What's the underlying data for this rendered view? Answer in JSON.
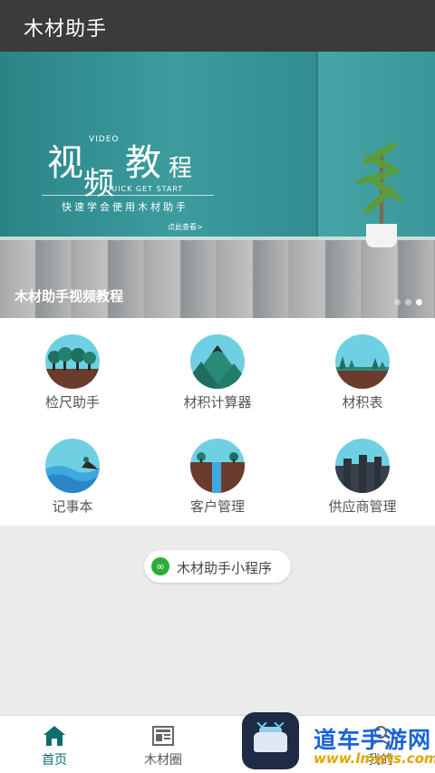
{
  "app": {
    "title": "木材助手"
  },
  "banner": {
    "title_chars": [
      "视",
      "频",
      "教",
      "程"
    ],
    "video_tag": "VIDEO",
    "quick_tag": "QUICK GET START",
    "subtitle": "快速学会使用木材助手",
    "link": "点此查看>",
    "caption": "木材助手视频教程",
    "dots": 3,
    "active_dot": 2
  },
  "features": [
    {
      "label": "检尺助手",
      "icon": "forest-trees-icon"
    },
    {
      "label": "材积计算器",
      "icon": "mountain-icon"
    },
    {
      "label": "材积表",
      "icon": "grass-landscape-icon"
    },
    {
      "label": "记事本",
      "icon": "wave-island-icon"
    },
    {
      "label": "客户管理",
      "icon": "waterfall-icon"
    },
    {
      "label": "供应商管理",
      "icon": "city-skyline-icon"
    }
  ],
  "mini_program": {
    "label": "木材助手小程序",
    "icon": "link-icon"
  },
  "tabs": [
    {
      "label": "首页",
      "icon": "home-icon",
      "active": true
    },
    {
      "label": "木材圈",
      "icon": "news-icon",
      "active": false
    },
    {
      "label": "",
      "icon": "",
      "active": false
    },
    {
      "label": "我的",
      "icon": "user-icon",
      "active": false
    }
  ],
  "watermark": {
    "name": "道车手游网",
    "url": "www.lmwts.com"
  },
  "colors": {
    "topbar": "#3b3b3b",
    "accent": "#0f6b6e",
    "banner": "#2f8a8c"
  }
}
